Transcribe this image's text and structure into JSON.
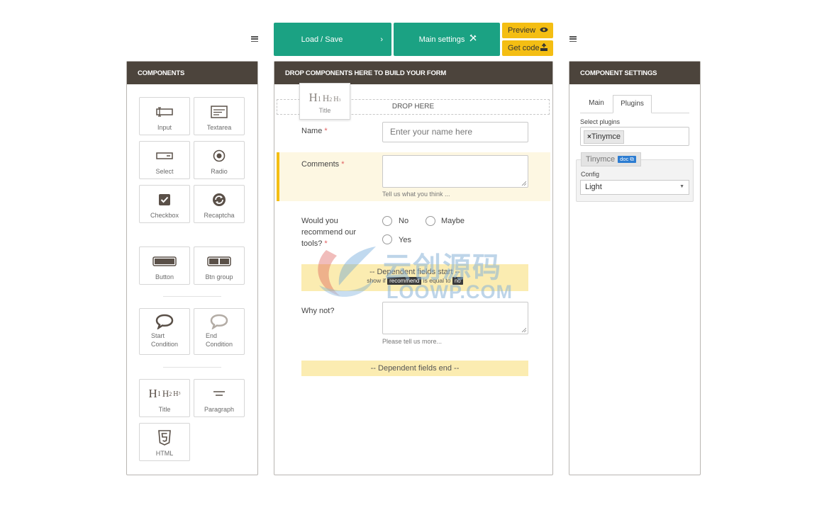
{
  "toolbar": {
    "load_save": "Load / Save",
    "main_settings": "Main settings",
    "preview": "Preview",
    "get_code": "Get code"
  },
  "components_panel": {
    "title": "COMPONENTS",
    "items": {
      "input": "Input",
      "textarea": "Textarea",
      "select": "Select",
      "radio": "Radio",
      "checkbox": "Checkbox",
      "recaptcha": "Recaptcha",
      "button": "Button",
      "btn_group": "Btn group",
      "start_condition_1": "Start",
      "start_condition_2": "Condition",
      "end_condition_1": "End",
      "end_condition_2": "Condition",
      "title": "Title",
      "paragraph": "Paragraph",
      "html": "HTML"
    }
  },
  "form_panel": {
    "title": "DROP COMPONENTS HERE TO BUILD YOUR FORM",
    "drop_here": "DROP HERE",
    "drag_ghost_label": "Title",
    "fields": {
      "name_label": "Name",
      "name_placeholder": "Enter your name here",
      "comments_label": "Comments",
      "comments_help": "Tell us what you think ...",
      "recommend_label_1": "Would you",
      "recommend_label_2": "recommend our",
      "recommend_label_3": "tools?",
      "recommend_options": [
        "No",
        "Maybe",
        "Yes"
      ],
      "dep_start": "-- Dependent fields start --",
      "dep_show_if": "show if",
      "dep_field": "recommend",
      "dep_is_equal": "is equal to",
      "dep_value": "no",
      "whynot_label": "Why not?",
      "whynot_help": "Please tell us more...",
      "dep_end": "-- Dependent fields end --"
    },
    "required_mark": "*"
  },
  "settings_panel": {
    "title": "COMPONENT SETTINGS",
    "tabs": [
      "Main",
      "Plugins"
    ],
    "active_tab": "Plugins",
    "select_plugins_label": "Select plugins",
    "selected_plugin": "Tinymce",
    "plugin_box_title": "Tinymce",
    "plugin_doc_badge": "doc",
    "config_label": "Config",
    "config_value": "Light"
  },
  "watermark": {
    "line1": "云创源码",
    "line2": "LOOWP.COM"
  },
  "colors": {
    "green": "#1ba283",
    "yellow": "#f4be13",
    "header_brown": "#4c443c",
    "dependent_bg": "#fbecb1",
    "highlight_row": "#fdf7e2",
    "highlight_bar": "#f4be13"
  }
}
